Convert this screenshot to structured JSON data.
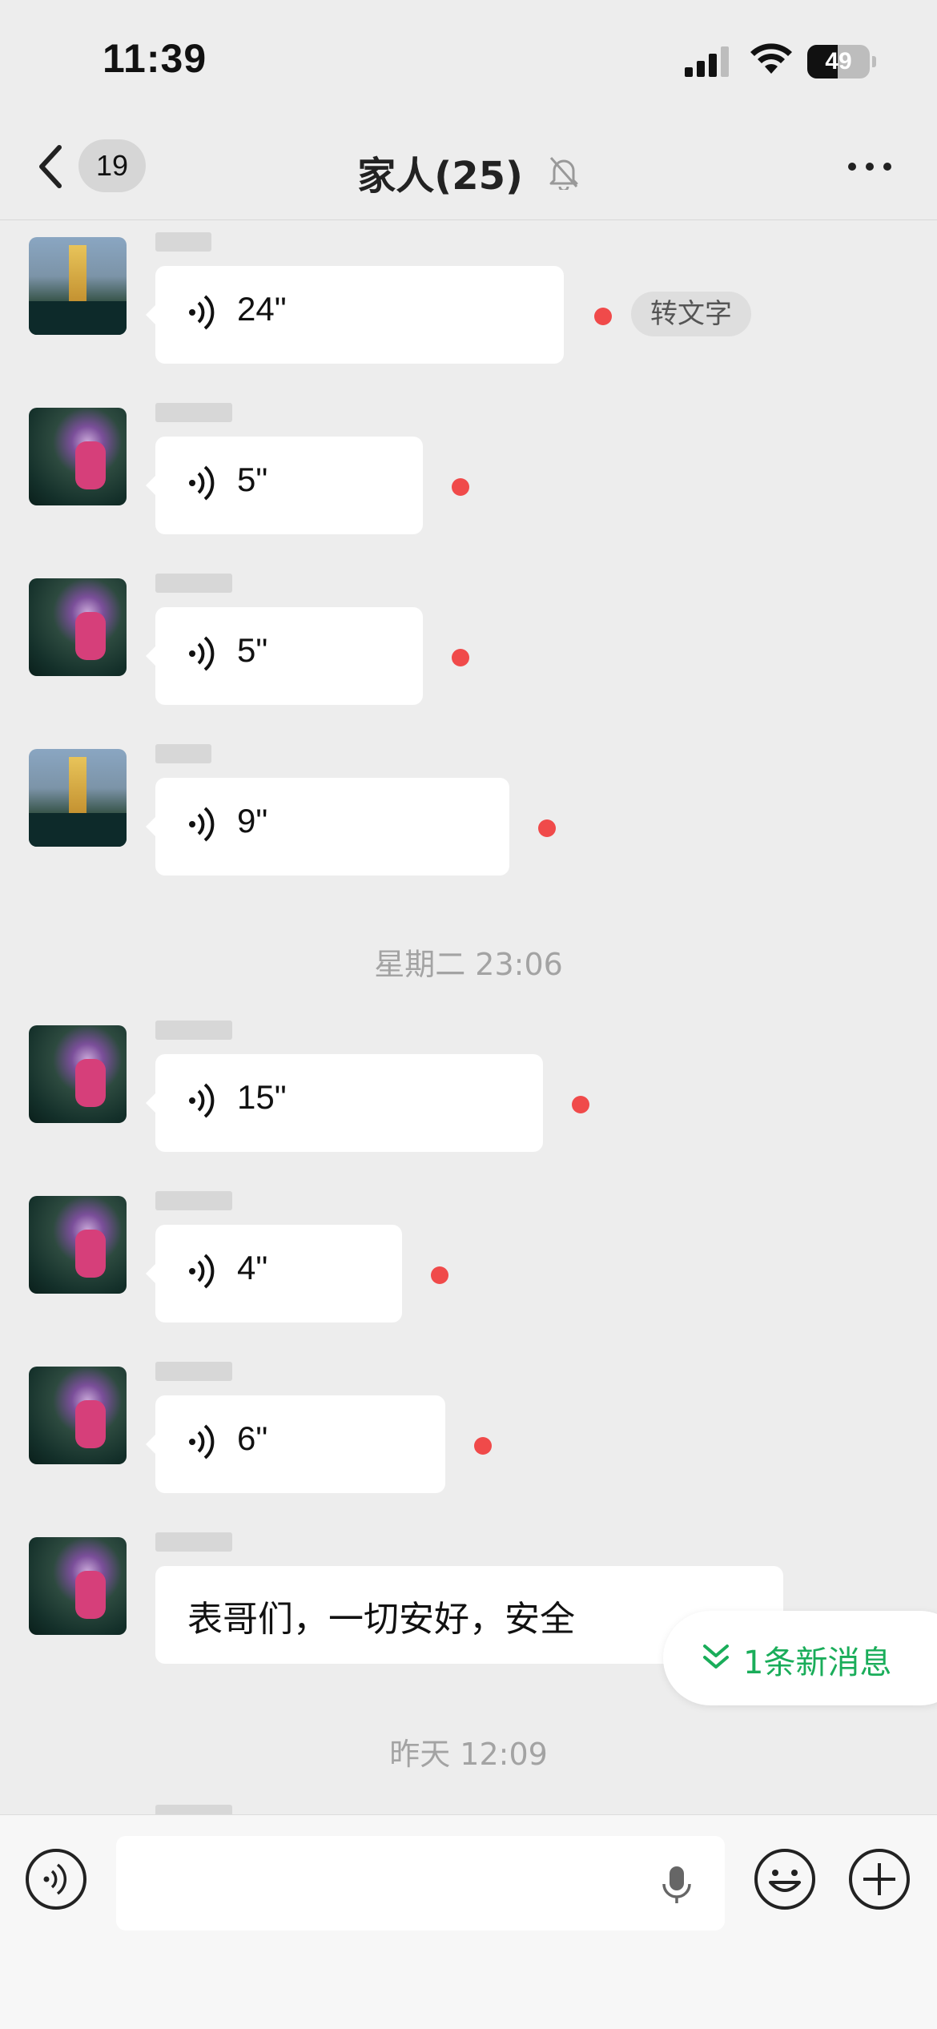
{
  "status_bar": {
    "time": "11:39",
    "battery": "49",
    "battery_level": 0.49
  },
  "nav": {
    "unread_count": "19",
    "title": "家人(25)"
  },
  "messages": [
    {
      "type": "voice",
      "avatar": "tower",
      "duration": "24\"",
      "unread": true,
      "action": "转文字"
    },
    {
      "type": "voice",
      "avatar": "flower",
      "duration": "5\"",
      "unread": true
    },
    {
      "type": "voice",
      "avatar": "flower",
      "duration": "5\"",
      "unread": true
    },
    {
      "type": "voice",
      "avatar": "tower",
      "duration": "9\"",
      "unread": true
    },
    {
      "type": "timestamp",
      "text": "星期二 23:06"
    },
    {
      "type": "voice",
      "avatar": "flower",
      "duration": "15\"",
      "unread": true
    },
    {
      "type": "voice",
      "avatar": "flower",
      "duration": "4\"",
      "unread": true
    },
    {
      "type": "voice",
      "avatar": "flower",
      "duration": "6\"",
      "unread": true
    },
    {
      "type": "text",
      "avatar": "flower",
      "text": "表哥们，一切安好，安全"
    },
    {
      "type": "timestamp",
      "text": "昨天 12:09"
    }
  ],
  "new_message_pill": {
    "label": "1条新消息"
  },
  "colors": {
    "unread_dot": "#f04a4a",
    "accent_green": "#1aad5a",
    "background": "#ededed"
  }
}
